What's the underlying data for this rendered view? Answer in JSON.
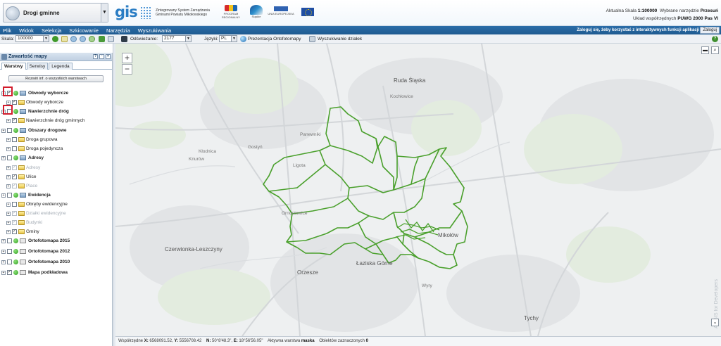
{
  "header": {
    "layer_select": "Drogi gminne",
    "gis_logo": "gis",
    "gis_text": "Zintegrowany System Zarządzania Gminami Powiatu Mikołowskiego",
    "logo_program": "PROGRAM REGIONALNY",
    "logo_region": "Śląskie",
    "logo_union": "UNIA EUROPEJSKA",
    "scale_label": "Aktualna Skala",
    "scale_value": "1:100000",
    "tool_label": "Wybrane narzędzie",
    "tool_value": "Przesuń",
    "crs_label": "Układ współrzędnych",
    "crs_value": "PUWG 2000 Pas VI"
  },
  "menu": {
    "items": [
      "Plik",
      "Widok",
      "Selekcja",
      "Szkicowanie",
      "Narzędzia",
      "Wyszukiwania"
    ],
    "login_msg": "Zaloguj się, żeby korzystać z interaktywnych funkcji aplikacji",
    "login_btn": "Zaloguj"
  },
  "toolbar": {
    "scale_label": "Skala:",
    "scale_value": "100000",
    "refresh_label": "Odświeżanie:",
    "refresh_value": "2177",
    "lang_label": "Języki:",
    "lang_value": "PL",
    "orto_label": "Prezentacja Ortofotomapy",
    "search_label": "Wyszukiwanie działek",
    "help": "?"
  },
  "panel": {
    "title": "Zawartość mapy",
    "tabs": [
      "Warstwy",
      "Serwisy",
      "Legenda"
    ],
    "info_btn": "Rozwiń inf. o wszystkich warstwach",
    "tree": [
      {
        "label": "Obwody wyborcze",
        "level": 0,
        "group": true,
        "checked": true
      },
      {
        "label": "Obwody wyborcze",
        "level": 1,
        "group": false,
        "checked": true
      },
      {
        "label": "Nawierzchnie dróg",
        "level": 0,
        "group": true,
        "checked": false
      },
      {
        "label": "Nawierzchnie dróg gminnych",
        "level": 1,
        "group": false,
        "checked": true
      },
      {
        "label": "Obszary drogowe",
        "level": 0,
        "group": true,
        "checked": false
      },
      {
        "label": "Droga grupowa",
        "level": 1,
        "group": false,
        "checked": false
      },
      {
        "label": "Droga pojedyncza",
        "level": 1,
        "group": false,
        "checked": false
      },
      {
        "label": "Adresy",
        "level": 0,
        "group": true,
        "checked": false
      },
      {
        "label": "Adresy",
        "level": 1,
        "group": false,
        "checked": true,
        "muted": true
      },
      {
        "label": "Ulice",
        "level": 1,
        "group": false,
        "checked": true
      },
      {
        "label": "Place",
        "level": 1,
        "group": false,
        "checked": true,
        "muted": true
      },
      {
        "label": "Ewidencja",
        "level": 0,
        "group": true,
        "checked": false
      },
      {
        "label": "Obręby ewidencyjne",
        "level": 1,
        "group": false,
        "checked": false
      },
      {
        "label": "Działki ewidencyjne",
        "level": 1,
        "group": false,
        "checked": true,
        "muted": true
      },
      {
        "label": "Budynki",
        "level": 1,
        "group": false,
        "checked": true,
        "muted": true
      },
      {
        "label": "Gminy",
        "level": 1,
        "group": false,
        "checked": true
      },
      {
        "label": "Ortofotomapa 2015",
        "level": 0,
        "group": true,
        "checked": false
      },
      {
        "label": "Ortofotomapa 2012",
        "level": 0,
        "group": true,
        "checked": false
      },
      {
        "label": "Ortofotomapa 2010",
        "level": 0,
        "group": true,
        "checked": false
      },
      {
        "label": "Mapa podkładowa",
        "level": 0,
        "group": true,
        "checked": true
      }
    ]
  },
  "map": {
    "labels": [
      {
        "text": "Ruda Śląska",
        "big": true
      },
      {
        "text": "Kochłowice",
        "big": false
      },
      {
        "text": "Panewniki",
        "big": false
      },
      {
        "text": "Kłodnica",
        "big": false
      },
      {
        "text": "Ligota",
        "big": false
      },
      {
        "text": "Gostyń",
        "big": false
      },
      {
        "text": "Ornontowice",
        "big": false
      },
      {
        "text": "Czerwionka-Leszczyny",
        "big": true
      },
      {
        "text": "Orzesze",
        "big": true
      },
      {
        "text": "Łaziska Górne",
        "big": true
      },
      {
        "text": "Wyry",
        "big": false
      },
      {
        "text": "Tychy",
        "big": true
      },
      {
        "text": "Knurów",
        "big": false
      },
      {
        "text": "Mikołów",
        "big": true
      }
    ],
    "attribution": "ArcGIS for Developers",
    "boundary_color": "#4aa02c"
  },
  "status": {
    "coords_label": "Współrzędne",
    "x": "6568091.52",
    "y": "5556708.42",
    "n": "50°8'48.3\"",
    "e": "18°56'56.05\"",
    "active_label": "Aktywna warstwa",
    "active_value": "maska",
    "selected_label": "Obiektów zaznaczonych",
    "selected_value": "0"
  }
}
